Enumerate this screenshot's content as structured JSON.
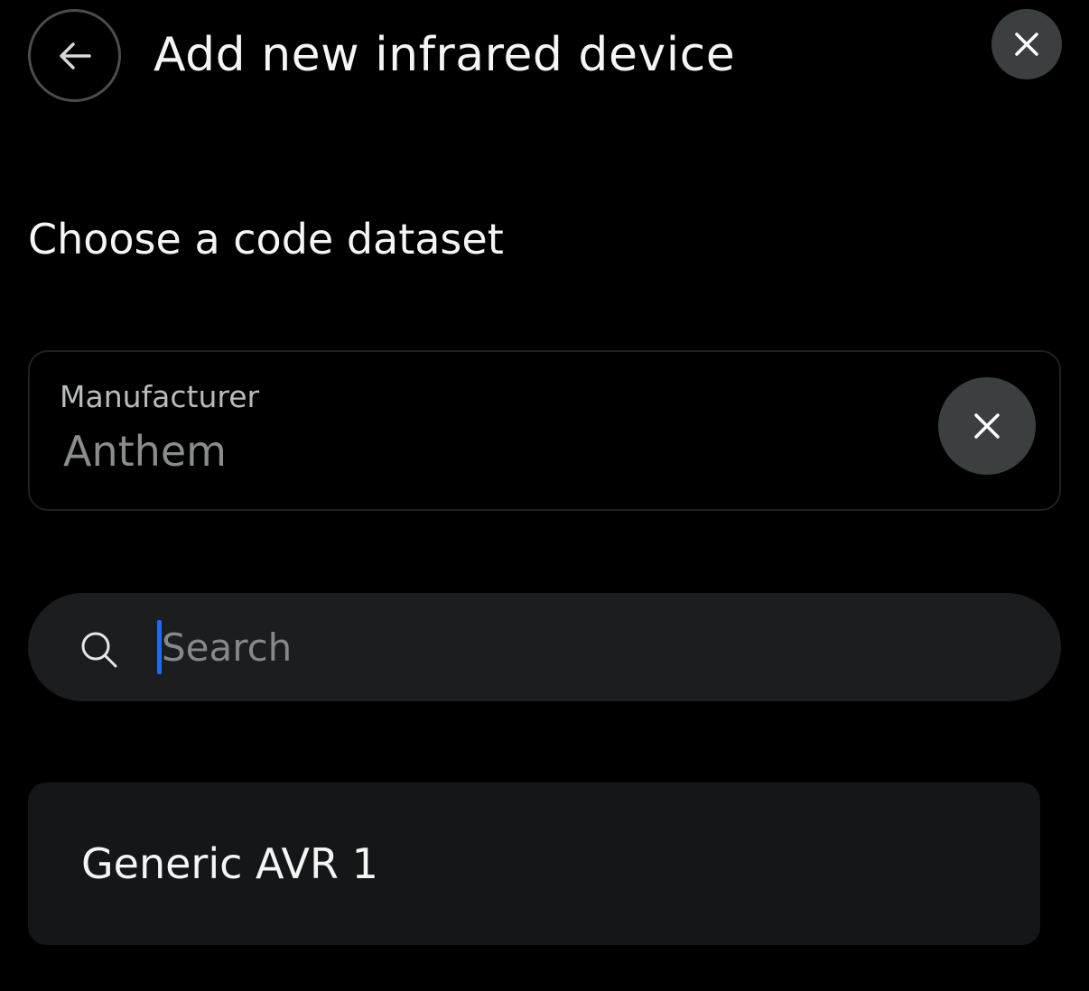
{
  "header": {
    "title": "Add new infrared device",
    "back_icon": "arrow-left-icon",
    "close_icon": "close-icon"
  },
  "section": {
    "title": "Choose a code dataset"
  },
  "manufacturer": {
    "label": "Manufacturer",
    "value": "Anthem",
    "clear_icon": "close-icon"
  },
  "search": {
    "placeholder": "Search",
    "value": "",
    "icon": "search-icon"
  },
  "datasets": [
    {
      "label": "Generic AVR 1"
    }
  ],
  "colors": {
    "background": "#000000",
    "surface": "#1b1d1e",
    "button": "#3b3f40",
    "caret": "#1a6cf2"
  }
}
